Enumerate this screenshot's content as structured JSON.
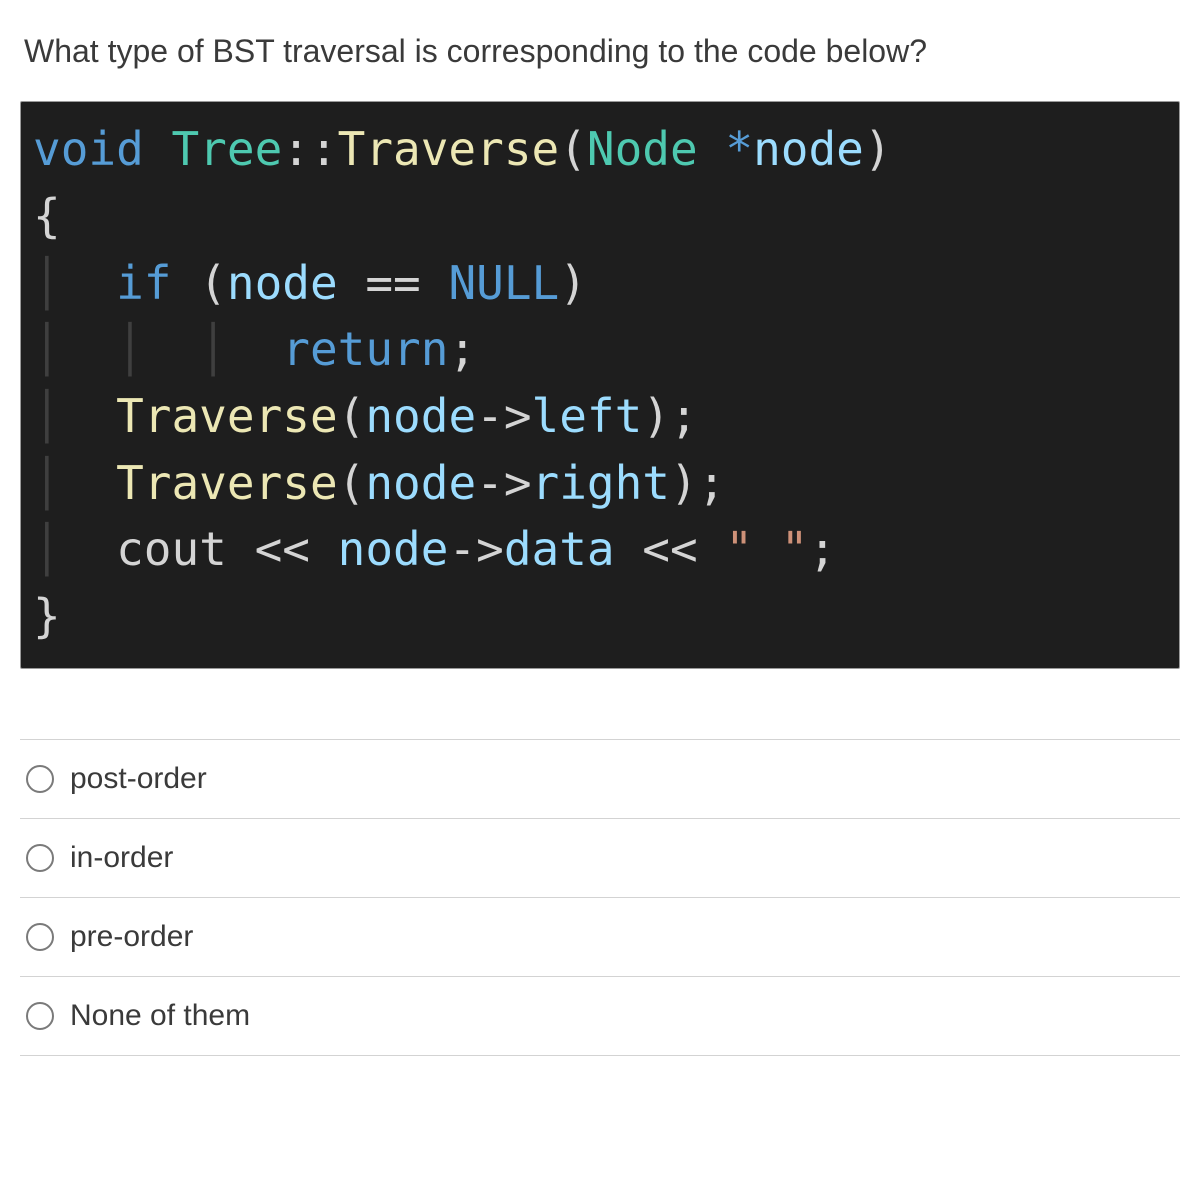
{
  "question": "What type of BST traversal is corresponding to the code below?",
  "code": {
    "sig_void": "void",
    "sig_class": "Tree",
    "sig_scope": "::",
    "sig_fn": "Traverse",
    "sig_paren_open": "(",
    "sig_param_type": "Node",
    "sig_star": " *",
    "sig_param_name": "node",
    "sig_paren_close": ")",
    "brace_open": "{",
    "if_kw": "if",
    "if_open": " (",
    "if_var": "node",
    "if_eq": " == ",
    "if_null": "NULL",
    "if_close": ")",
    "return_kw": "return",
    "return_semi": ";",
    "call1_fn": "Traverse",
    "call1_open": "(",
    "call1_obj": "node",
    "call1_arrow": "->",
    "call1_member": "left",
    "call1_close": ");",
    "call2_fn": "Traverse",
    "call2_open": "(",
    "call2_obj": "node",
    "call2_arrow": "->",
    "call2_member": "right",
    "call2_close": ");",
    "cout": "cout",
    "cout_op1": " << ",
    "cout_obj": "node",
    "cout_arrow": "->",
    "cout_member": "data",
    "cout_op2": " << ",
    "cout_str": "\" \"",
    "cout_semi": ";",
    "brace_close": "}"
  },
  "options": [
    {
      "label": "post-order"
    },
    {
      "label": "in-order"
    },
    {
      "label": "pre-order"
    },
    {
      "label": "None of them"
    }
  ]
}
